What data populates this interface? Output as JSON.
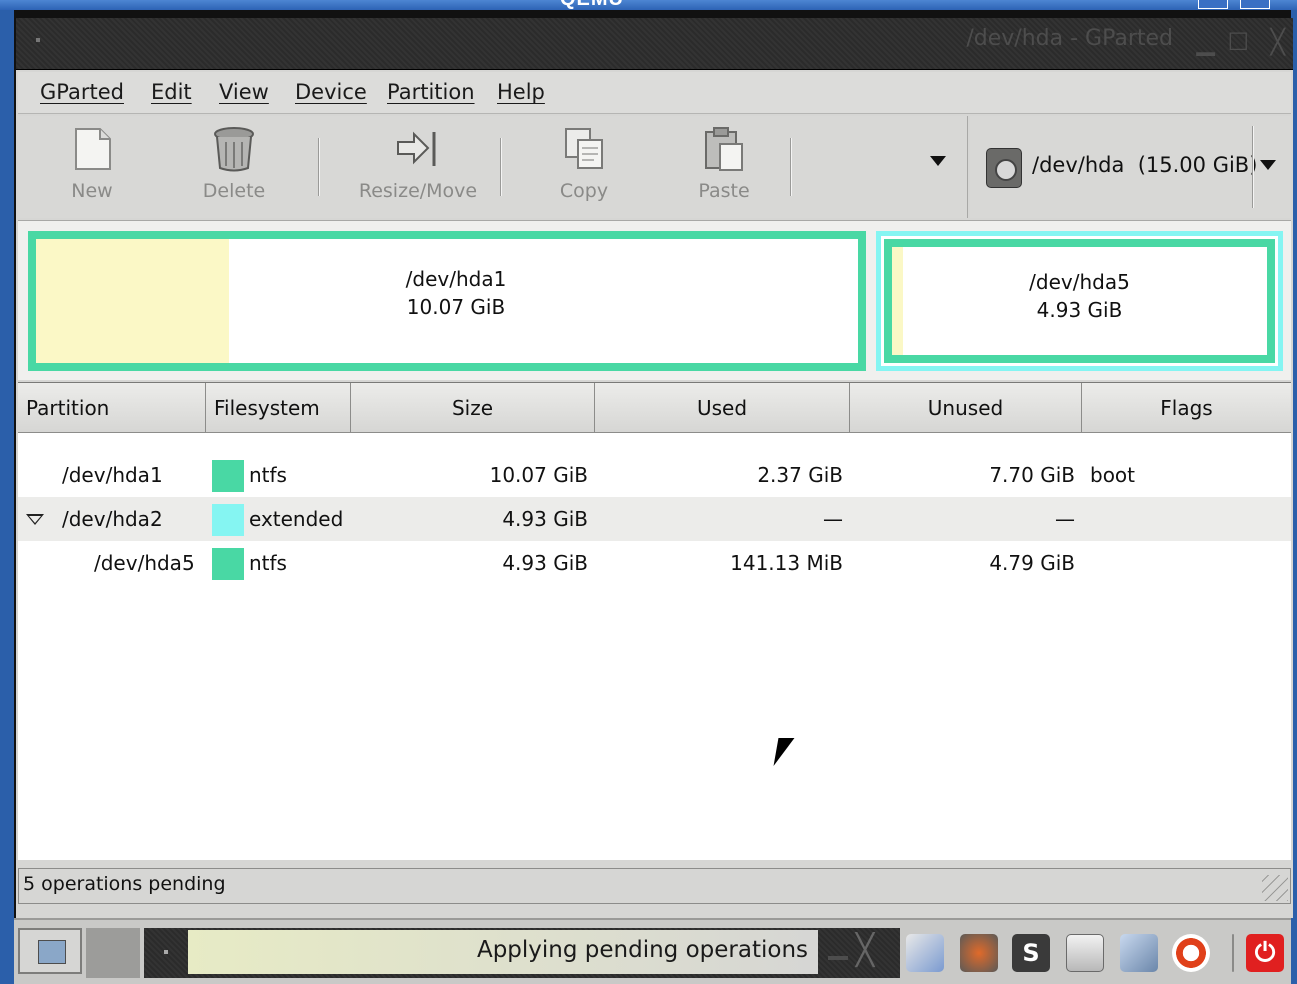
{
  "qemu": {
    "title": "QEMU"
  },
  "window": {
    "title": "/dev/hda - GParted"
  },
  "menu": {
    "items": [
      "GParted",
      "Edit",
      "View",
      "Device",
      "Partition",
      "Help"
    ]
  },
  "toolbar": {
    "new_label": "New",
    "delete_label": "Delete",
    "resize_label": "Resize/Move",
    "copy_label": "Copy",
    "paste_label": "Paste"
  },
  "device": {
    "name": "/dev/hda",
    "size": "(15.00 GiB)"
  },
  "map": {
    "hda1": {
      "name": "/dev/hda1",
      "size": "10.07 GiB",
      "used_fraction": 0.235,
      "color": "#49d8a4"
    },
    "hda5": {
      "name": "/dev/hda5",
      "size": "4.93 GiB",
      "used_fraction": 0.03,
      "color": "#49d8a4"
    },
    "extended_color": "#85f5f2",
    "used_color": "#fbf8c6"
  },
  "table": {
    "headers": [
      "Partition",
      "Filesystem",
      "Size",
      "Used",
      "Unused",
      "Flags"
    ],
    "rows": [
      {
        "partition": "/dev/hda1",
        "filesystem": "ntfs",
        "fs_color": "#49d8a4",
        "size": "10.07 GiB",
        "used": "2.37 GiB",
        "unused": "7.70 GiB",
        "flags": "boot"
      },
      {
        "partition": "/dev/hda2",
        "filesystem": "extended",
        "fs_color": "#85f5f2",
        "size": "4.93 GiB",
        "used": "—",
        "unused": "—",
        "flags": ""
      },
      {
        "partition": "/dev/hda5",
        "filesystem": "ntfs",
        "fs_color": "#49d8a4",
        "size": "4.93 GiB",
        "used": "141.13 MiB",
        "unused": "4.79 GiB",
        "flags": ""
      }
    ]
  },
  "status": {
    "text": "5 operations pending"
  },
  "taskbar": {
    "task_label": "Applying pending operations"
  }
}
